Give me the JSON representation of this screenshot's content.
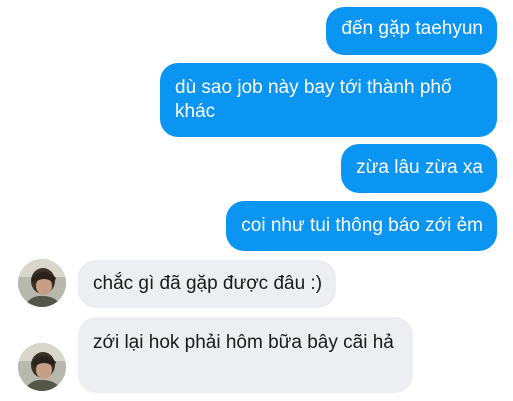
{
  "conversation": {
    "messages": [
      {
        "side": "sent",
        "text": "đến gặp taehyun"
      },
      {
        "side": "sent",
        "text": "dù sao job này bay tới thành phố khác"
      },
      {
        "side": "sent",
        "text": "zừa lâu zừa xa"
      },
      {
        "side": "sent",
        "text": "coi như tui thông báo zới ẻm"
      },
      {
        "side": "received",
        "text": "chắc gì đã gặp được đâu :)"
      },
      {
        "side": "received",
        "text": "zới lại hok phải hôm bữa bây cãi hả"
      }
    ]
  },
  "colors": {
    "sent_bubble": "#0a95f3",
    "received_bubble": "#eceef1",
    "sent_text": "#ffffff",
    "received_text": "#1b1b1b"
  },
  "icons": {
    "contact_avatar": "profile-photo-avatar"
  }
}
